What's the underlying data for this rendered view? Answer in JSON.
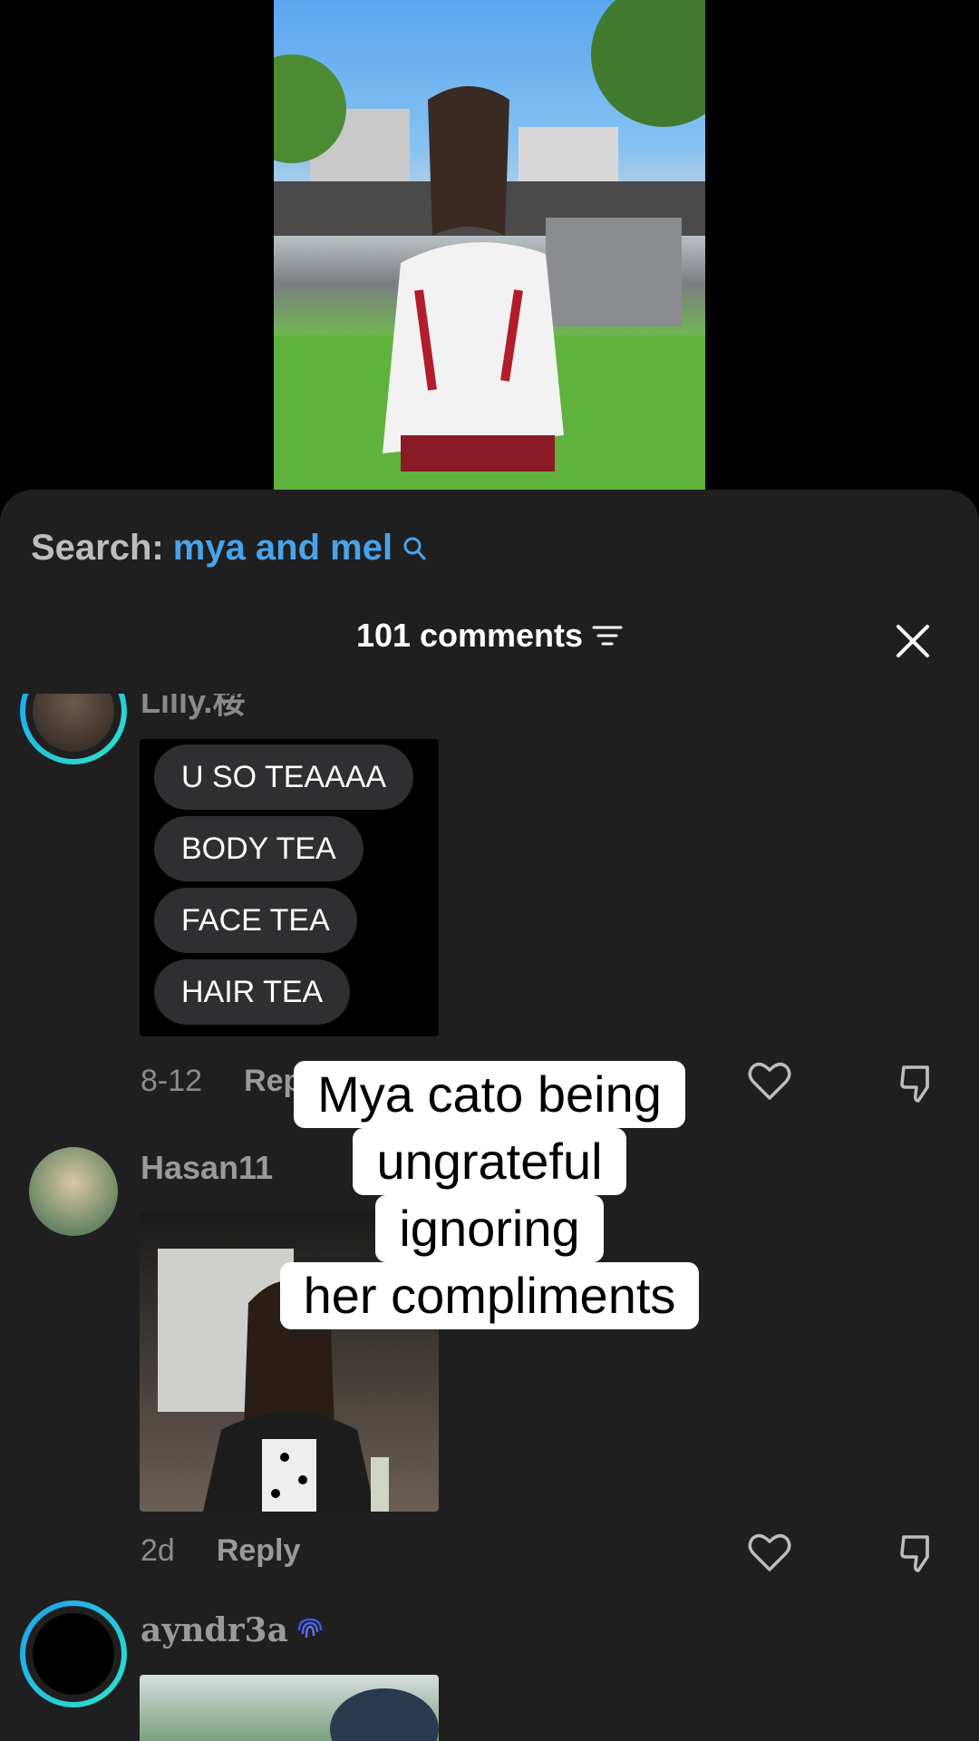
{
  "search": {
    "label": "Search:",
    "term": "mya and mel"
  },
  "header": {
    "comments_count_label": "101 comments"
  },
  "overlay_caption": [
    "Mya cato being",
    "ungrateful",
    "ignoring",
    "her compliments"
  ],
  "comments": [
    {
      "username": "Lilly.桜",
      "bubbles": [
        "U SO TEAAAA",
        "BODY TEA",
        "FACE TEA",
        "HAIR TEA"
      ],
      "date": "8-12",
      "reply_label": "Reply"
    },
    {
      "username": "Hasan11",
      "date": "2d",
      "reply_label": "Reply"
    },
    {
      "username": "ayndr3a"
    }
  ],
  "colors": {
    "accent_blue": "#4aa3e9",
    "sheet_bg": "#1f1f20",
    "ring_start": "#1ea0f0",
    "ring_end": "#2fe4c8"
  }
}
